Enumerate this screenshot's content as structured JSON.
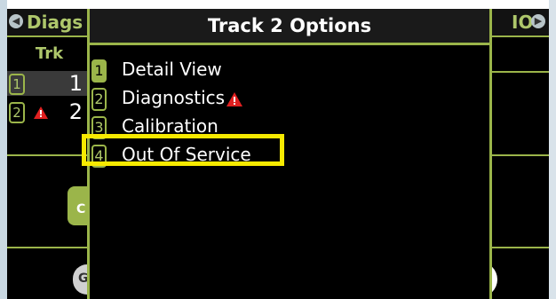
{
  "popup": {
    "title": "Track 2 Options",
    "items": [
      {
        "number": "1",
        "label": "Detail View",
        "warning": false
      },
      {
        "number": "2",
        "label": "Diagnostics",
        "warning": true
      },
      {
        "number": "3",
        "label": "Calibration",
        "warning": false
      },
      {
        "number": "4",
        "label": "Out Of Service",
        "warning": false
      }
    ]
  },
  "background": {
    "left_tab": "Diags",
    "right_tab": "IO",
    "column_header": "Trk",
    "tracks": [
      {
        "number": "1",
        "value": "1",
        "warning": false
      },
      {
        "number": "2",
        "value": "2",
        "warning": true
      }
    ],
    "green_button_letter": "C",
    "grey_button_letter": "G"
  },
  "colors": {
    "accent_green": "#9bb54a",
    "highlight_yellow": "#f7ea00",
    "warning_red": "#e02020"
  },
  "icons": {
    "nav_left": "chevron-left-icon",
    "nav_right": "chevron-right-icon",
    "warning": "warning-triangle-icon"
  }
}
